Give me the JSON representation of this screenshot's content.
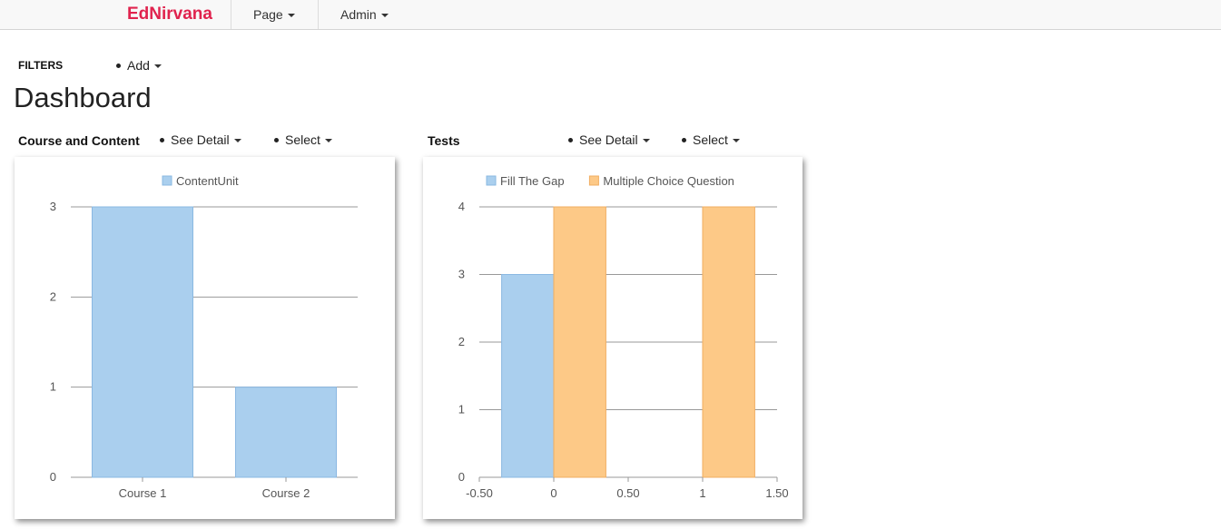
{
  "nav": {
    "brand": "EdNirvana",
    "items": [
      {
        "label": "Page"
      },
      {
        "label": "Admin"
      }
    ]
  },
  "filters": {
    "label": "FILTERS",
    "add_label": "Add"
  },
  "page_title": "Dashboard",
  "sections": [
    {
      "title": "Course and Content",
      "detail_label": "See Detail",
      "select_label": "Select"
    },
    {
      "title": "Tests",
      "detail_label": "See Detail",
      "select_label": "Select"
    }
  ],
  "colors": {
    "brand": "#e0234e",
    "blue": "#aacfee",
    "blue_stroke": "#8ab8e2",
    "orange": "#fdc987",
    "orange_stroke": "#f0ae62",
    "grid": "#999999"
  },
  "chart_data": [
    {
      "type": "bar",
      "categories": [
        "Course 1",
        "Course 2"
      ],
      "series": [
        {
          "name": "ContentUnit",
          "values": [
            3,
            1
          ]
        }
      ],
      "ylim": [
        0,
        3
      ],
      "yticks": [
        "0",
        "1",
        "2",
        "3"
      ],
      "legend": "top-center",
      "grid": true
    },
    {
      "type": "bar",
      "x_ticks": [
        "-0.50",
        "0",
        "0.50",
        "1",
        "1.50"
      ],
      "xlim": [
        -0.5,
        1.5
      ],
      "series": [
        {
          "name": "Fill The Gap",
          "points": [
            {
              "x": 0,
              "y": 3
            }
          ]
        },
        {
          "name": "Multiple Choice Question",
          "points": [
            {
              "x": 0,
              "y": 4
            },
            {
              "x": 1,
              "y": 4
            }
          ]
        }
      ],
      "ylim": [
        0,
        4
      ],
      "yticks": [
        "0",
        "1",
        "2",
        "3",
        "4"
      ],
      "legend": "top-center",
      "grid": true
    }
  ]
}
